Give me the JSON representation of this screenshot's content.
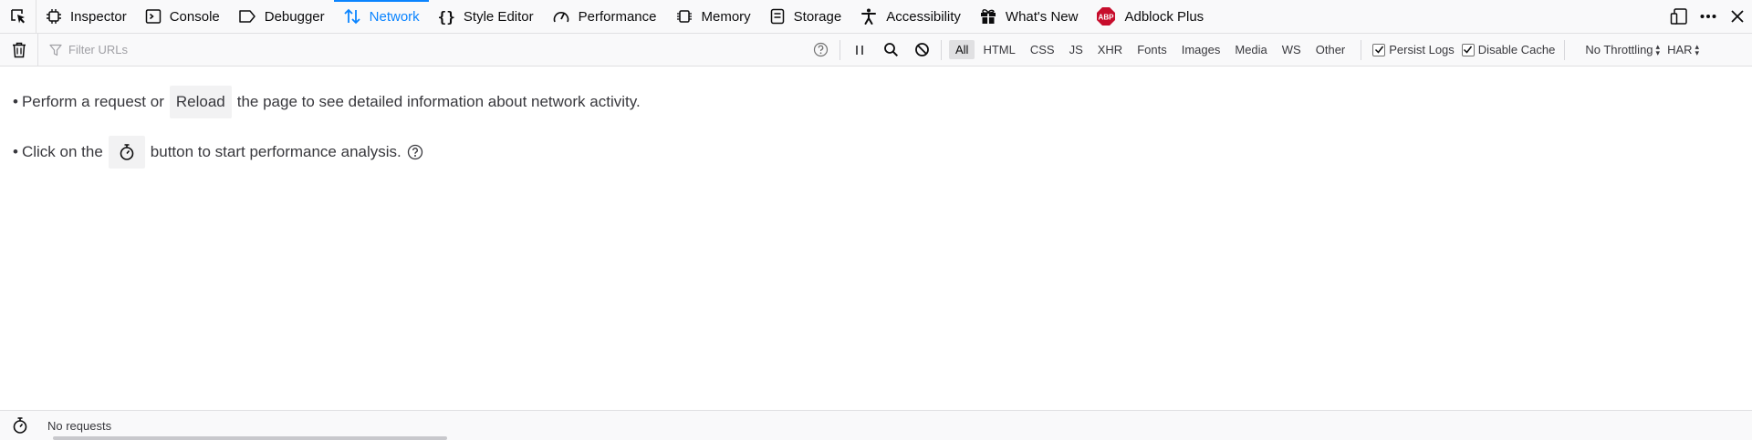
{
  "tabs": [
    {
      "label": "Inspector",
      "icon": "inspector-icon",
      "selected": false
    },
    {
      "label": "Console",
      "icon": "console-icon",
      "selected": false
    },
    {
      "label": "Debugger",
      "icon": "debugger-icon",
      "selected": false
    },
    {
      "label": "Network",
      "icon": "network-icon",
      "selected": true
    },
    {
      "label": "Style Editor",
      "icon": "style-editor-icon",
      "selected": false
    },
    {
      "label": "Performance",
      "icon": "performance-icon",
      "selected": false
    },
    {
      "label": "Memory",
      "icon": "memory-icon",
      "selected": false
    },
    {
      "label": "Storage",
      "icon": "storage-icon",
      "selected": false
    },
    {
      "label": "Accessibility",
      "icon": "accessibility-icon",
      "selected": false
    },
    {
      "label": "What's New",
      "icon": "gift-icon",
      "selected": false
    },
    {
      "label": "Adblock Plus",
      "icon": "adblock-plus-icon",
      "selected": false,
      "badge": "ABP"
    }
  ],
  "toolbar": {
    "filter_placeholder": "Filter URLs",
    "types": [
      "All",
      "HTML",
      "CSS",
      "JS",
      "XHR",
      "Fonts",
      "Images",
      "Media",
      "WS",
      "Other"
    ],
    "active_type": "All",
    "persist_logs": {
      "label": "Persist Logs",
      "checked": true
    },
    "disable_cache": {
      "label": "Disable Cache",
      "checked": true
    },
    "throttling": "No Throttling",
    "har": "HAR"
  },
  "empty": {
    "line1_pre": "Perform a request or",
    "reload": "Reload",
    "line1_post": "the page to see detailed information about network activity.",
    "line2_pre": "Click on the",
    "line2_post": "button to start performance analysis."
  },
  "status": {
    "text": "No requests"
  },
  "colors": {
    "accent": "#0a84ff",
    "abp_red": "#c70d2c"
  }
}
